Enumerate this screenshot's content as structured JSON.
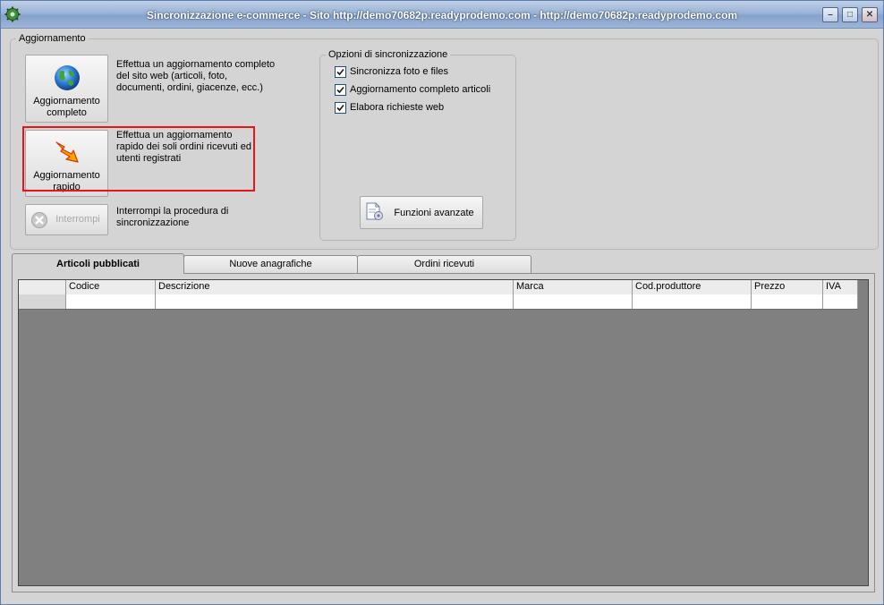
{
  "window": {
    "title": "Sincronizzazione e-commerce - Sito http://demo70682p.readyprodemo.com - http://demo70682p.readyprodemo.com",
    "controls": [
      "minimize",
      "maximize",
      "close"
    ],
    "accent": "#9ab3d6"
  },
  "aggiornamento": {
    "group_label": "Aggiornamento",
    "completo": {
      "label_line1": "Aggiornamento",
      "label_line2": "completo",
      "desc_line1": "Effettua un aggiornamento completo",
      "desc_line2": "del sito web (articoli, foto,",
      "desc_line3": "documenti, ordini, giacenze, ecc.)",
      "icon": "globe-icon"
    },
    "rapido": {
      "label_line1": "Aggiornamento",
      "label_line2": "rapido",
      "desc_line1": "Effettua un aggiornamento",
      "desc_line2": "rapido dei soli ordini ricevuti ed",
      "desc_line3": "utenti registrati",
      "icon": "lightning-arrow-icon",
      "highlight_color": "#e8141c"
    },
    "interrompi": {
      "label": "Interrompi",
      "desc_line1": "Interrompi la procedura di",
      "desc_line2": "sincronizzazione",
      "disabled": true,
      "icon": "stop-icon"
    }
  },
  "opzioni": {
    "group_label": "Opzioni di sincronizzazione",
    "options": [
      {
        "label": "Sincronizza foto e files",
        "checked": true
      },
      {
        "label": "Aggiornamento completo articoli",
        "checked": true
      },
      {
        "label": "Elabora richieste web",
        "checked": true
      }
    ],
    "funzioni_label": "Funzioni avanzate",
    "funzioni_icon": "document-gear-icon"
  },
  "tabs": [
    {
      "label": "Articoli pubblicati",
      "active": true
    },
    {
      "label": "Nuove anagrafiche",
      "active": false
    },
    {
      "label": "Ordini ricevuti",
      "active": false
    }
  ],
  "grid": {
    "columns": [
      "Codice",
      "Descrizione",
      "Marca",
      "Cod.produttore",
      "Prezzo",
      "IVA"
    ]
  }
}
